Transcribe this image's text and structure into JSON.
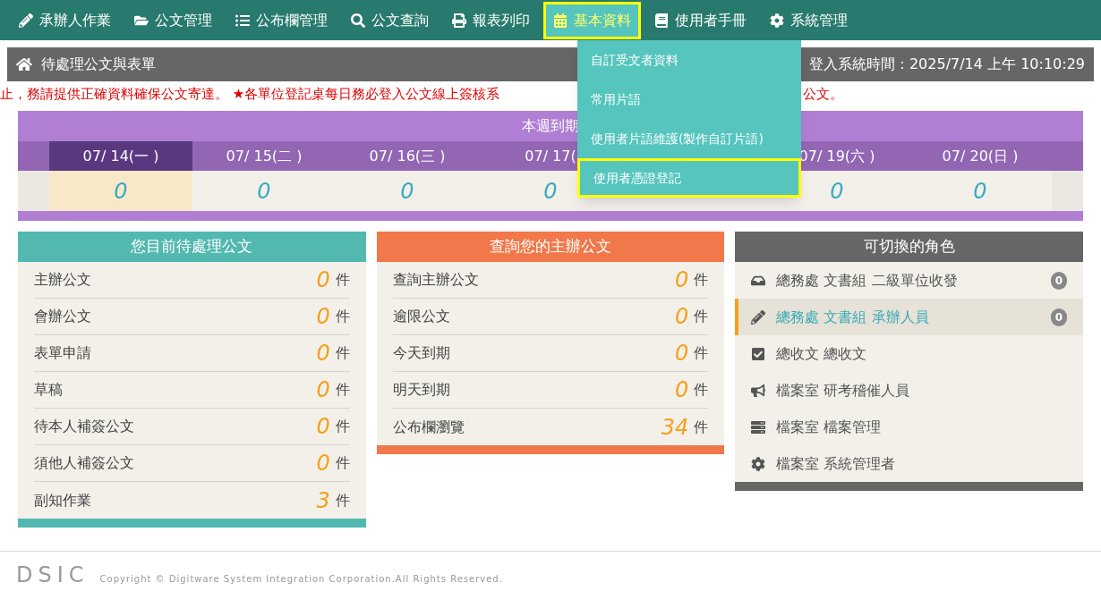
{
  "nav": [
    {
      "label": "承辦人作業",
      "selected": false
    },
    {
      "label": "公文管理",
      "selected": false
    },
    {
      "label": "公布欄管理",
      "selected": false
    },
    {
      "label": "公文查詢",
      "selected": false
    },
    {
      "label": "報表列印",
      "selected": false
    },
    {
      "label": "基本資料",
      "selected": true
    },
    {
      "label": "使用者手冊",
      "selected": false
    },
    {
      "label": "系統管理",
      "selected": false
    }
  ],
  "dropdown": [
    {
      "label": "自訂受文者資料",
      "selected": false
    },
    {
      "label": "常用片語",
      "selected": false
    },
    {
      "label": "使用者片語維護(製作自訂片語)",
      "selected": false
    },
    {
      "label": "使用者憑證登記",
      "selected": true
    }
  ],
  "page_header": {
    "title": "待處理公文與表單",
    "login_time": "登入系統時間：2025/7/14 上午 10:10:29"
  },
  "notice": [
    "止，務請提供正確資料確保公文寄達。 ★各單位登記桌每日務必登入公文線上簽核系",
    "公文。"
  ],
  "week": {
    "title": "本週到期",
    "days": [
      {
        "label": "07/ 14(一 )",
        "value": "0",
        "selected": true
      },
      {
        "label": "07/ 15(二 )",
        "value": "0",
        "selected": false
      },
      {
        "label": "07/ 16(三 )",
        "value": "0",
        "selected": false
      },
      {
        "label": "07/ 17(",
        "value": "0",
        "selected": false
      },
      {
        "label": "07/ 19(六 )",
        "value": "0",
        "selected": false
      },
      {
        "label": "07/ 20(日 )",
        "value": "0",
        "selected": false
      }
    ]
  },
  "pending": {
    "title": "您目前待處理公文",
    "rows": [
      {
        "label": "主辦公文",
        "count": "0",
        "unit": "件"
      },
      {
        "label": "會辦公文",
        "count": "0",
        "unit": "件"
      },
      {
        "label": "表單申請",
        "count": "0",
        "unit": "件"
      },
      {
        "label": "草稿",
        "count": "0",
        "unit": "件"
      },
      {
        "label": "待本人補簽公文",
        "count": "0",
        "unit": "件"
      },
      {
        "label": "須他人補簽公文",
        "count": "0",
        "unit": "件"
      },
      {
        "label": "副知作業",
        "count": "3",
        "unit": "件"
      }
    ]
  },
  "query": {
    "title": "查詢您的主辦公文",
    "rows": [
      {
        "label": "查詢主辦公文",
        "count": "0",
        "unit": "件"
      },
      {
        "label": "逾限公文",
        "count": "0",
        "unit": "件"
      },
      {
        "label": "今天到期",
        "count": "0",
        "unit": "件"
      },
      {
        "label": "明天到期",
        "count": "0",
        "unit": "件"
      },
      {
        "label": "公布欄瀏覽",
        "count": "34",
        "unit": "件"
      }
    ]
  },
  "roles": {
    "title": "可切換的角色",
    "items": [
      {
        "label": "總務處 文書組 二級單位收發",
        "badge": "0",
        "selected": false
      },
      {
        "label": "總務處 文書組 承辦人員",
        "badge": "0",
        "selected": true
      },
      {
        "label": "總收文 總收文",
        "selected": false
      },
      {
        "label": "檔案室 研考稽催人員",
        "selected": false
      },
      {
        "label": "檔案室 檔案管理",
        "selected": false
      },
      {
        "label": "檔案室 系統管理者",
        "selected": false
      }
    ]
  },
  "footer": {
    "logo": "DSIC",
    "copyright": "Copyright © Digitware System Integration Corporation.All Rights Reserved."
  }
}
